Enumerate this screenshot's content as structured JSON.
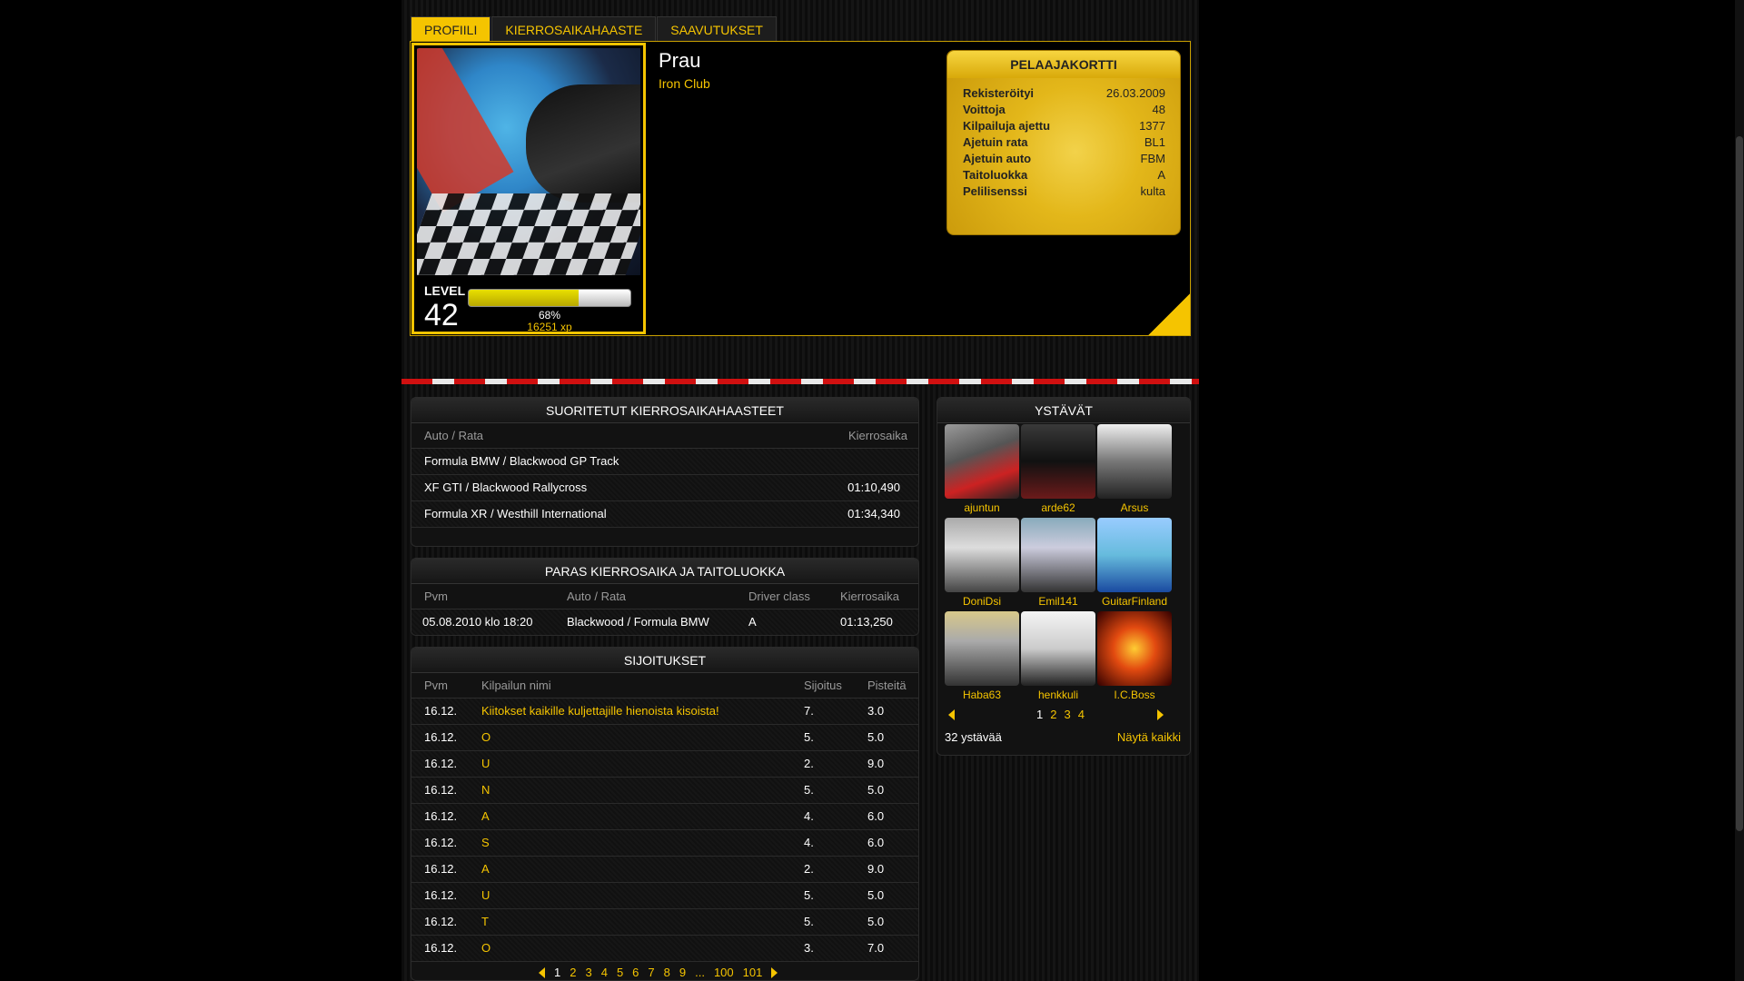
{
  "tabs": [
    {
      "label": "PROFIILI",
      "active": true
    },
    {
      "label": "KIERROSAIKAHAASTE",
      "active": false
    },
    {
      "label": "SAAVUTUKSET",
      "active": false
    }
  ],
  "profile": {
    "name": "Prau",
    "club": "Iron Club",
    "level_label": "LEVEL",
    "level": "42",
    "xp_percent_text": "68%",
    "xp_progress": 0.68,
    "xp_amount": "16251 xp"
  },
  "player_card": {
    "title": "PELAAJAKORTTI",
    "rows": [
      {
        "key": "Rekisteröityi",
        "value": "26.03.2009"
      },
      {
        "key": "Voittoja",
        "value": "48"
      },
      {
        "key": "Kilpailuja ajettu",
        "value": "1377"
      },
      {
        "key": "Ajetuin rata",
        "value": "BL1"
      },
      {
        "key": "Ajetuin auto",
        "value": "FBM"
      },
      {
        "key": "Taitoluokka",
        "value": "A"
      },
      {
        "key": "Pelilisenssi",
        "value": "kulta"
      }
    ]
  },
  "completed": {
    "title": "SUORITETUT KIERROSAIKAHAASTEET",
    "col_track": "Auto / Rata",
    "col_time": "Kierrosaika",
    "rows": [
      {
        "track": "Formula BMW / Blackwood GP Track",
        "time": ""
      },
      {
        "track": "XF GTI / Blackwood Rallycross",
        "time": "01:10,490"
      },
      {
        "track": "Formula XR / Westhill International",
        "time": "01:34,340"
      }
    ]
  },
  "best": {
    "title": "PARAS KIERROSAIKA JA TAITOLUOKKA",
    "col_date": "Pvm",
    "col_track": "Auto / Rata",
    "col_class": "Driver class",
    "col_time": "Kierrosaika",
    "row": {
      "date": "05.08.2010 klo 18:20",
      "track": "Blackwood / Formula BMW",
      "class": "A",
      "time": "01:13,250"
    }
  },
  "placements": {
    "title": "SIJOITUKSET",
    "col_date": "Pvm",
    "col_name": "Kilpailun nimi",
    "col_place": "Sijoitus",
    "col_points": "Pisteitä",
    "rows": [
      {
        "date": "16.12.",
        "name": "Kiitokset kaikille kuljettajille hienoista kisoista!",
        "place": "7.",
        "points": "3.0"
      },
      {
        "date": "16.12.",
        "name": "O",
        "place": "5.",
        "points": "5.0"
      },
      {
        "date": "16.12.",
        "name": "U",
        "place": "2.",
        "points": "9.0"
      },
      {
        "date": "16.12.",
        "name": "N",
        "place": "5.",
        "points": "5.0"
      },
      {
        "date": "16.12.",
        "name": "A",
        "place": "4.",
        "points": "6.0"
      },
      {
        "date": "16.12.",
        "name": "S",
        "place": "4.",
        "points": "6.0"
      },
      {
        "date": "16.12.",
        "name": "A",
        "place": "2.",
        "points": "9.0"
      },
      {
        "date": "16.12.",
        "name": "U",
        "place": "5.",
        "points": "5.0"
      },
      {
        "date": "16.12.",
        "name": "T",
        "place": "5.",
        "points": "5.0"
      },
      {
        "date": "16.12.",
        "name": "O",
        "place": "3.",
        "points": "7.0"
      }
    ],
    "pages": [
      "1",
      "2",
      "3",
      "4",
      "5",
      "6",
      "7",
      "8",
      "9",
      "...",
      "100",
      "101"
    ]
  },
  "friends": {
    "title": "YSTÄVÄT",
    "list": [
      {
        "name": "ajuntun"
      },
      {
        "name": "arde62"
      },
      {
        "name": "Arsus"
      },
      {
        "name": "DoniDsi"
      },
      {
        "name": "Emil141"
      },
      {
        "name": "GuitarFinland"
      },
      {
        "name": "Haba63"
      },
      {
        "name": "henkkuli"
      },
      {
        "name": "I.C.Boss"
      }
    ],
    "pages": [
      "1",
      "2",
      "3",
      "4"
    ],
    "count": "32 ystävää",
    "show_all": "Näytä kaikki"
  },
  "colors": {
    "accent": "#f5c400",
    "track_red": "#d01010"
  },
  "icons": [
    "arrow-left-icon",
    "arrow-right-icon"
  ]
}
